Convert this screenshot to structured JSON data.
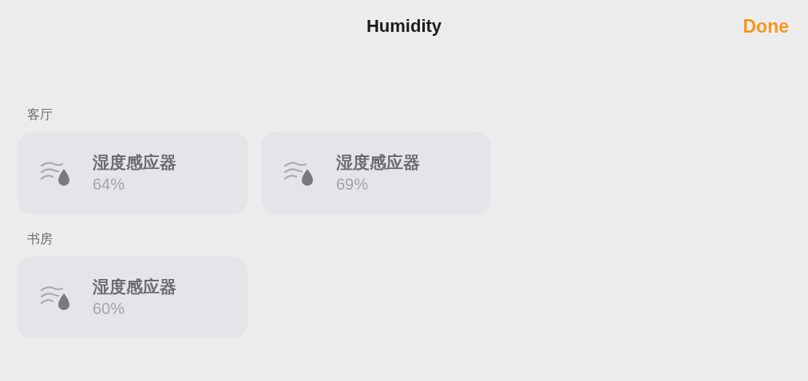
{
  "header": {
    "title": "Humidity",
    "done": "Done"
  },
  "rooms": [
    {
      "name": "客厅",
      "sensors": [
        {
          "name": "湿度感应器",
          "reading": "64%"
        },
        {
          "name": "湿度感应器",
          "reading": "69%"
        }
      ]
    },
    {
      "name": "书房",
      "sensors": [
        {
          "name": "湿度感应器",
          "reading": "60%"
        }
      ]
    }
  ]
}
